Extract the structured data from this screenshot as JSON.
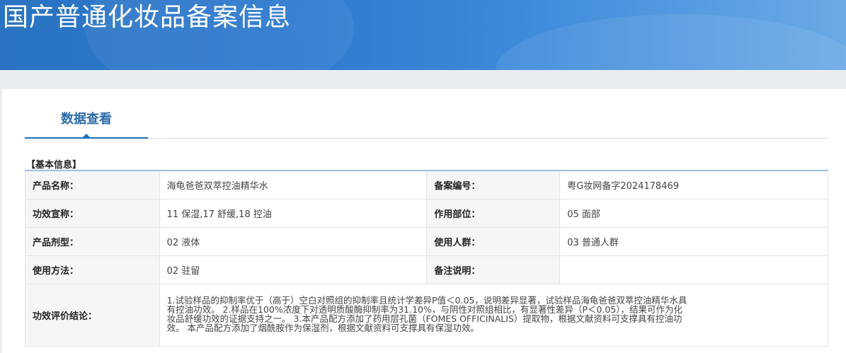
{
  "header": {
    "title": "国产普通化妆品备案信息"
  },
  "tabs": [
    {
      "label": "数据查看"
    }
  ],
  "section": {
    "title": "【基本信息】"
  },
  "rows": [
    {
      "k1": "产品名称：",
      "v1": "海龟爸爸双萃控油精华水",
      "k2": "备案编号：",
      "v2": "粤G妆网备字2024178469"
    },
    {
      "k1": "功效宣称：",
      "v1": "11 保湿,17 舒缓,18 控油",
      "k2": "作用部位：",
      "v2": "05 面部"
    },
    {
      "k1": "产品剂型：",
      "v1": "02 液体",
      "k2": "使用人群：",
      "v2": "03 普通人群"
    },
    {
      "k1": "使用方法：",
      "v1": "02 驻留",
      "k2": "备注说明：",
      "v2": ""
    }
  ],
  "conclusion": {
    "label": "功效评价结论：",
    "text": "1.试验样品的抑制率优于（高于）空白对照组的抑制率且统计学差异P值＜0.05，说明差异显著，试验样品海龟爸爸双萃控油精华水具有控油功效。 2.样品在100%浓度下对透明质酸酶抑制率为31.10%，与阴性对照组相比，有显著性差异（P＜0.05），结果可作为化妆品舒缓功效的证据支持之一。 3.本产品配方添加了药用层孔菌（FOMES OFFICINALIS）提取物，根据文献资料可支撑具有控油功效。 本产品配方添加了烟酰胺作为保湿剂，根据文献资料可支撑具有保湿功效。"
  },
  "colors": {
    "accent": "#1e6fbf",
    "banner": "#2e7ad0",
    "tab_text": "#2a6aa8"
  }
}
